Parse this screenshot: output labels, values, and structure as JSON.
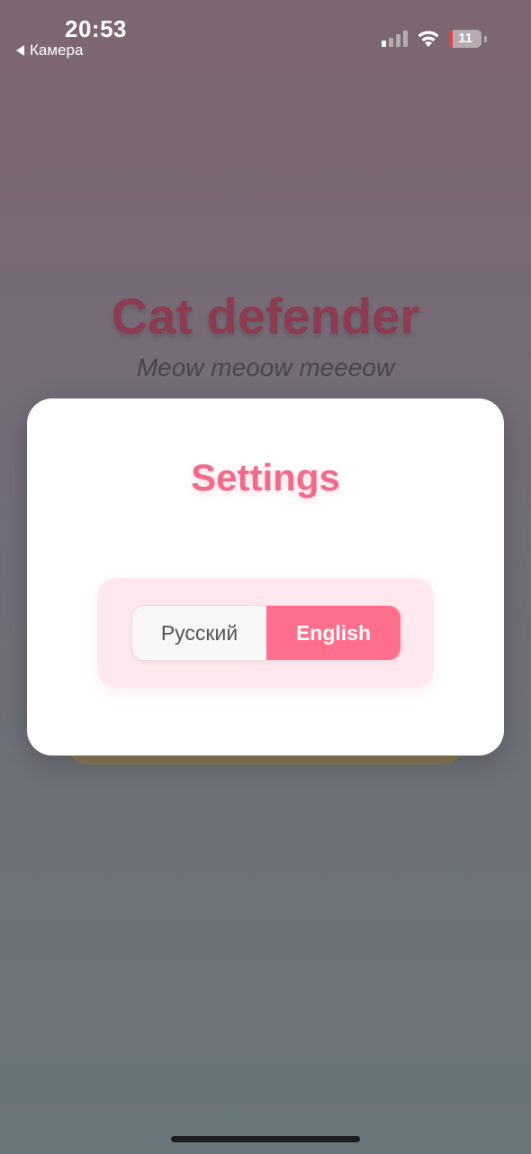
{
  "status_bar": {
    "time": "20:53",
    "back_label": "Камера",
    "battery_level": "11",
    "battery_fraction": 0.11,
    "signal_bars_active": 1,
    "signal_bars_total": 4,
    "icons": [
      "back-arrow-icon",
      "cellular-signal-icon",
      "wifi-icon",
      "battery-icon"
    ]
  },
  "app": {
    "title": "Cat defender",
    "subtitle": "Meow meoow meeeow"
  },
  "settings_modal": {
    "title": "Settings",
    "language_options": [
      {
        "label": "Русский",
        "selected": false
      },
      {
        "label": "English",
        "selected": true
      }
    ]
  },
  "colors": {
    "accent": "#ff6e8c",
    "title_pink": "#f06a8a",
    "app_title": "#8c3b50",
    "battery_low": "#e8413b"
  }
}
